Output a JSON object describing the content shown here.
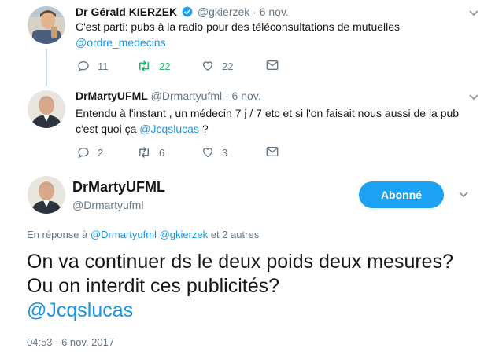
{
  "colors": {
    "accent": "#1da1f2",
    "link": "#1b95e0",
    "retweet": "#17bf63",
    "muted": "#657786",
    "thread": "#c4d9ee"
  },
  "tweet1": {
    "name": "Dr Gérald KIERZEK",
    "verified_icon": "verified-badge-icon",
    "handle": "@gkierzek",
    "time": "· 6 nov.",
    "text": "C'est parti: pubs à la radio pour des téléconsultations de mutuelles",
    "mention": "@ordre_medecins",
    "reply_count": "11",
    "retweet_count": "22",
    "like_count": "22"
  },
  "tweet2": {
    "name": "DrMartyUFML",
    "handle": "@Drmartyufml",
    "time": "· 6 nov.",
    "line1": "Entendu à l'instant , un médecin 7 j / 7 etc et si l'on faisait nous aussi de la pub",
    "line2_prefix": "c'est quoi ça ",
    "mention": "@Jcqslucas",
    "line2_suffix": " ?",
    "reply_count": "2",
    "retweet_count": "6",
    "like_count": "3"
  },
  "main": {
    "name": "DrMartyUFML",
    "handle": "@Drmartyufml",
    "follow_label": "Abonné",
    "reply_prefix": "En réponse à ",
    "reply_mention1": "@Drmartyufml",
    "reply_mention2": "@gkierzek",
    "reply_suffix": " et 2 autres",
    "text": "On va continuer ds le deux poids deux mesures? Ou on interdit ces publicités?",
    "mention": "@Jcqslucas",
    "timestamp": "04:53 - 6 nov. 2017"
  }
}
